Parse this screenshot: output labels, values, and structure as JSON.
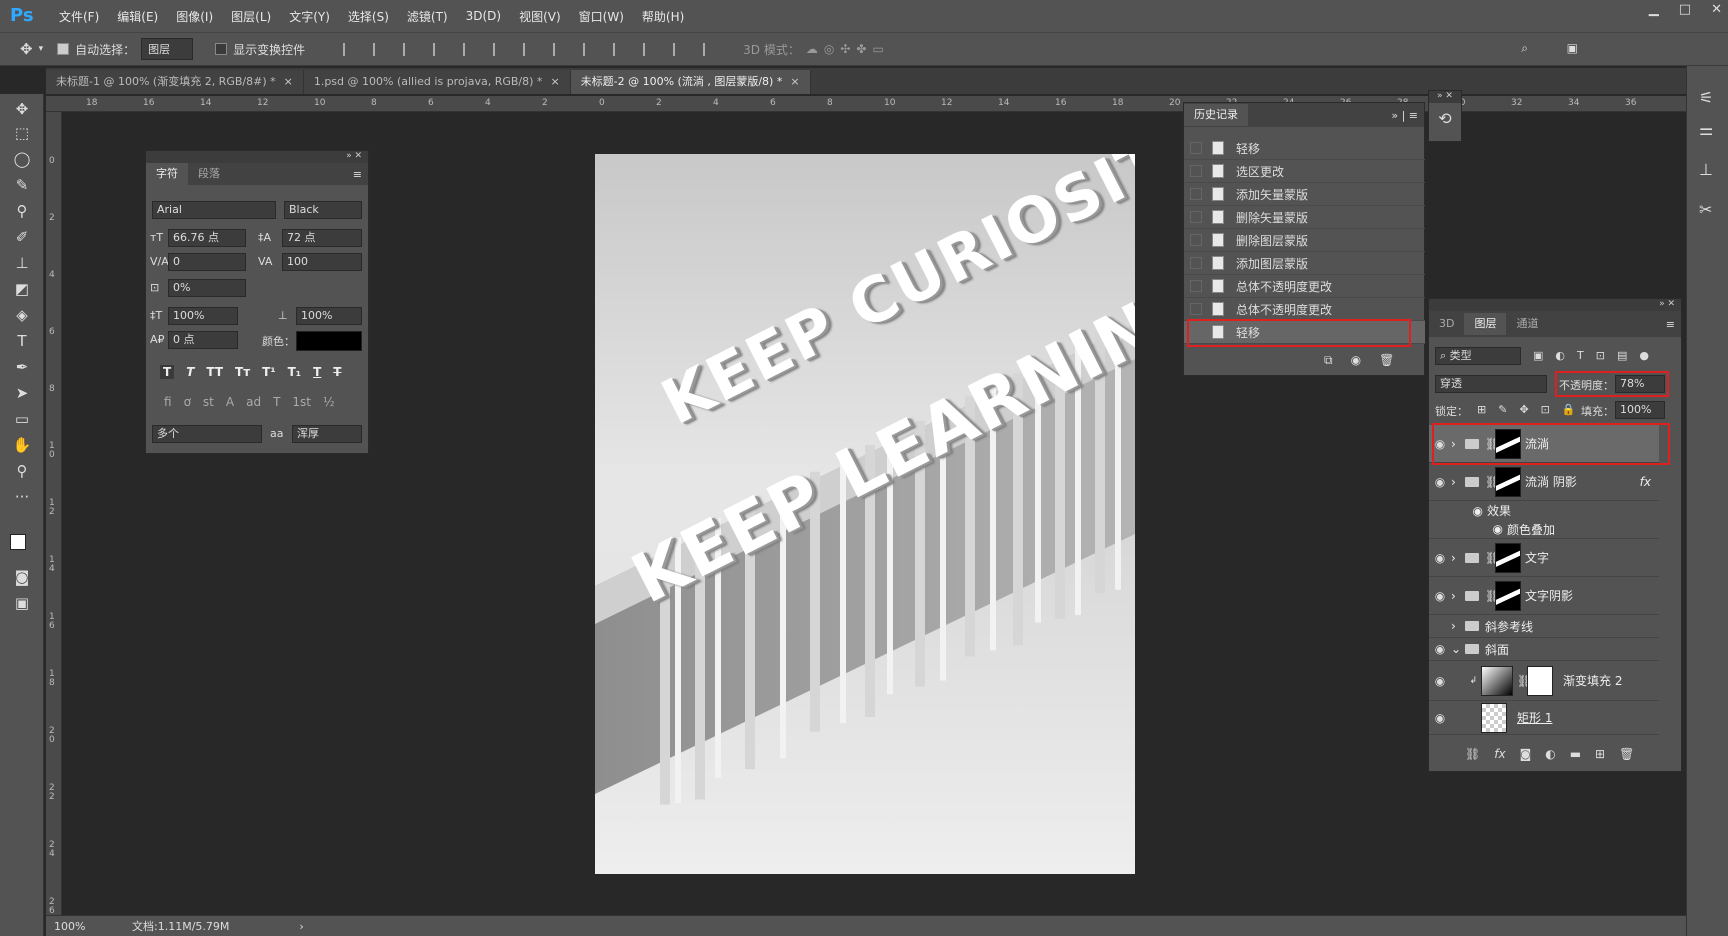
{
  "app": {
    "logo": "Ps"
  },
  "menu": [
    "文件(F)",
    "编辑(E)",
    "图像(I)",
    "图层(L)",
    "文字(Y)",
    "选择(S)",
    "滤镜(T)",
    "3D(D)",
    "视图(V)",
    "窗口(W)",
    "帮助(H)"
  ],
  "options": {
    "auto_select": "自动选择：",
    "auto_select_value": "图层",
    "show_transform": "显示变换控件",
    "mode_3d": "3D 模式："
  },
  "tabs": [
    {
      "label": "未标题-1 @ 100% (渐变填充 2, RGB/8#) *",
      "close": "×"
    },
    {
      "label": "1.psd @ 100% (allied is projava, RGB/8) *",
      "close": "×"
    },
    {
      "label": "未标题-2 @ 100% (流淌 , 图层蒙版/8) *",
      "close": "×"
    }
  ],
  "ruler_top": [
    "18",
    "16",
    "14",
    "12",
    "10",
    "8",
    "6",
    "4",
    "2",
    "0",
    "2",
    "4",
    "6",
    "8",
    "10",
    "12",
    "14",
    "16",
    "18",
    "20",
    "22",
    "24",
    "26",
    "28",
    "30",
    "32",
    "34",
    "36"
  ],
  "ruler_left": [
    "0",
    "2",
    "4",
    "6",
    "8",
    "1\n0",
    "1\n2",
    "1\n4",
    "1\n6",
    "1\n8",
    "2\n0",
    "2\n2",
    "2\n4",
    "2\n6"
  ],
  "character": {
    "tabs": [
      "字符",
      "段落"
    ],
    "font_family": "Arial",
    "font_style": "Black",
    "font_size": "66.76 点",
    "leading": "72 点",
    "kerning": "0",
    "tracking": "100",
    "tsume": "0%",
    "vscale": "100%",
    "hscale": "100%",
    "baseline": "0 点",
    "color_label": "颜色：",
    "language": "多个",
    "aa_label": "aa",
    "antialias": "浑厚",
    "styles": [
      "T",
      "T",
      "TT",
      "Tт",
      "T¹",
      "T₁",
      "T",
      "T"
    ],
    "ot": [
      "fi",
      "ơ",
      "st",
      "A",
      "ad",
      "T",
      "1st",
      "½"
    ]
  },
  "history": {
    "title": "历史记录",
    "items": [
      "轻移",
      "选区更改",
      "添加矢量蒙版",
      "删除矢量蒙版",
      "删除图层蒙版",
      "添加图层蒙版",
      "总体不透明度更改",
      "总体不透明度更改",
      "轻移"
    ]
  },
  "layers": {
    "tabs": [
      "3D",
      "图层",
      "通道"
    ],
    "filter": "类型",
    "blend": "穿透",
    "opacity_label": "不透明度：",
    "opacity": "78%",
    "lock_label": "锁定：",
    "fill_label": "填充：",
    "fill": "100%",
    "rows": [
      {
        "name": "流淌"
      },
      {
        "name": "流淌 阴影",
        "fx": "fx"
      },
      {
        "name": "效果"
      },
      {
        "name": "颜色叠加"
      },
      {
        "name": "文字"
      },
      {
        "name": "文字阴影"
      },
      {
        "name": "斜参考线"
      },
      {
        "name": "斜面"
      },
      {
        "name": "渐变填充 2"
      },
      {
        "name": "矩形 1"
      }
    ]
  },
  "artwork": {
    "line1": "KEEP CURIOSITY",
    "line2": "KEEP LEARNING"
  },
  "status": {
    "zoom": "100%",
    "doc": "文档:1.11M/5.79M"
  }
}
